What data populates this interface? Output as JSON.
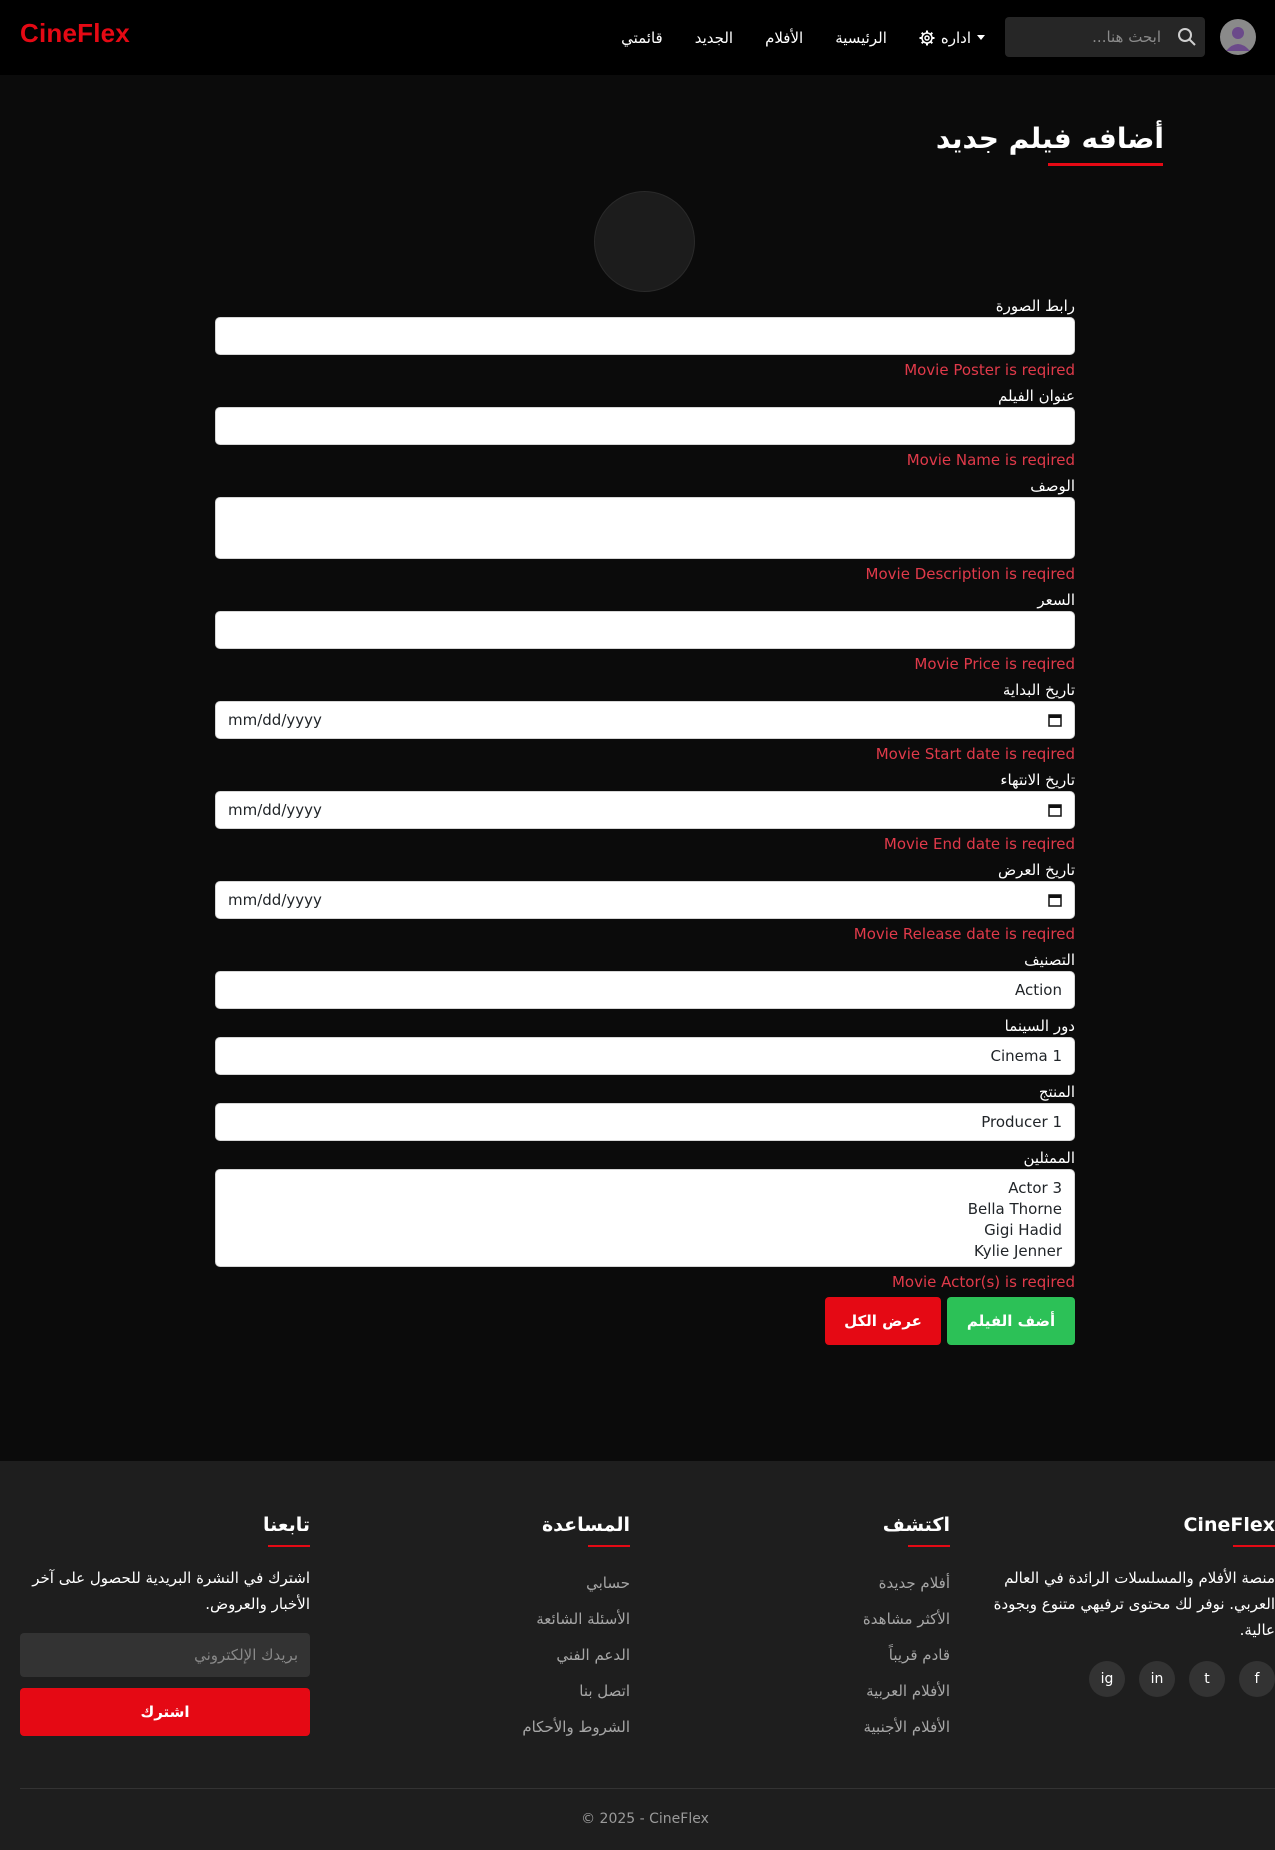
{
  "nav": {
    "brand": "CineFlex",
    "search_placeholder": "ابحث هنا...",
    "links": [
      "قائمتي",
      "الجديد",
      "الأفلام",
      "الرئيسية"
    ],
    "admin_label": "اداره"
  },
  "main": {
    "title": "أضافه فيلم جديد",
    "fields": {
      "poster": {
        "label": "رابط الصورة",
        "error": "Movie Poster is reqired"
      },
      "name": {
        "label": "عنوان الفيلم",
        "error": "Movie Name is reqired"
      },
      "description": {
        "label": "الوصف",
        "error": "Movie Description is reqired"
      },
      "price": {
        "label": "السعر",
        "error": "Movie Price is reqired"
      },
      "start_date": {
        "label": "تاريخ البداية",
        "placeholder": "mm/dd/yyyy",
        "error": "Movie Start date is reqired"
      },
      "end_date": {
        "label": "تاريخ الانتهاء",
        "placeholder": "mm/dd/yyyy",
        "error": "Movie End date is reqired"
      },
      "release_date": {
        "label": "تاريخ العرض",
        "placeholder": "mm/dd/yyyy",
        "error": "Movie Release date is reqired"
      },
      "category": {
        "label": "التصنيف",
        "value": "Action"
      },
      "cinema": {
        "label": "دور السينما",
        "value": "Cinema 1"
      },
      "producer": {
        "label": "المنتج",
        "value": "Producer 1"
      },
      "actors": {
        "label": "الممثلين",
        "options": [
          "Actor 3",
          "Bella Thorne",
          "Gigi Hadid",
          "Kylie Jenner"
        ],
        "error": "Movie Actor(s) is reqired"
      }
    },
    "add_button": "أضف الفيلم",
    "view_all_button": "عرض الكل"
  },
  "footer": {
    "brand": {
      "title": "CineFlex",
      "text": "منصة الأفلام والمسلسلات الرائدة في العالم العربي. نوفر لك محتوى ترفيهي متنوع وبجودة عالية.",
      "socials": [
        "f",
        "t",
        "in",
        "ig"
      ]
    },
    "discover": {
      "title": "اكتشف",
      "links": [
        "أفلام جديدة",
        "الأكثر مشاهدة",
        "قادم قريباً",
        "الأفلام العربية",
        "الأفلام الأجنبية"
      ]
    },
    "help": {
      "title": "المساعدة",
      "links": [
        "حسابي",
        "الأسئلة الشائعة",
        "الدعم الفني",
        "اتصل بنا",
        "الشروط والأحكام"
      ]
    },
    "follow": {
      "title": "تابعنا",
      "text": "اشترك في النشرة البريدية للحصول على آخر الأخبار والعروض.",
      "email_placeholder": "بريدك الإلكتروني",
      "subscribe": "اشترك"
    },
    "copyright": "© 2025 - CineFlex"
  },
  "colors": {
    "accent": "#e50914",
    "success": "#2cc157",
    "error": "#e03a4a"
  }
}
